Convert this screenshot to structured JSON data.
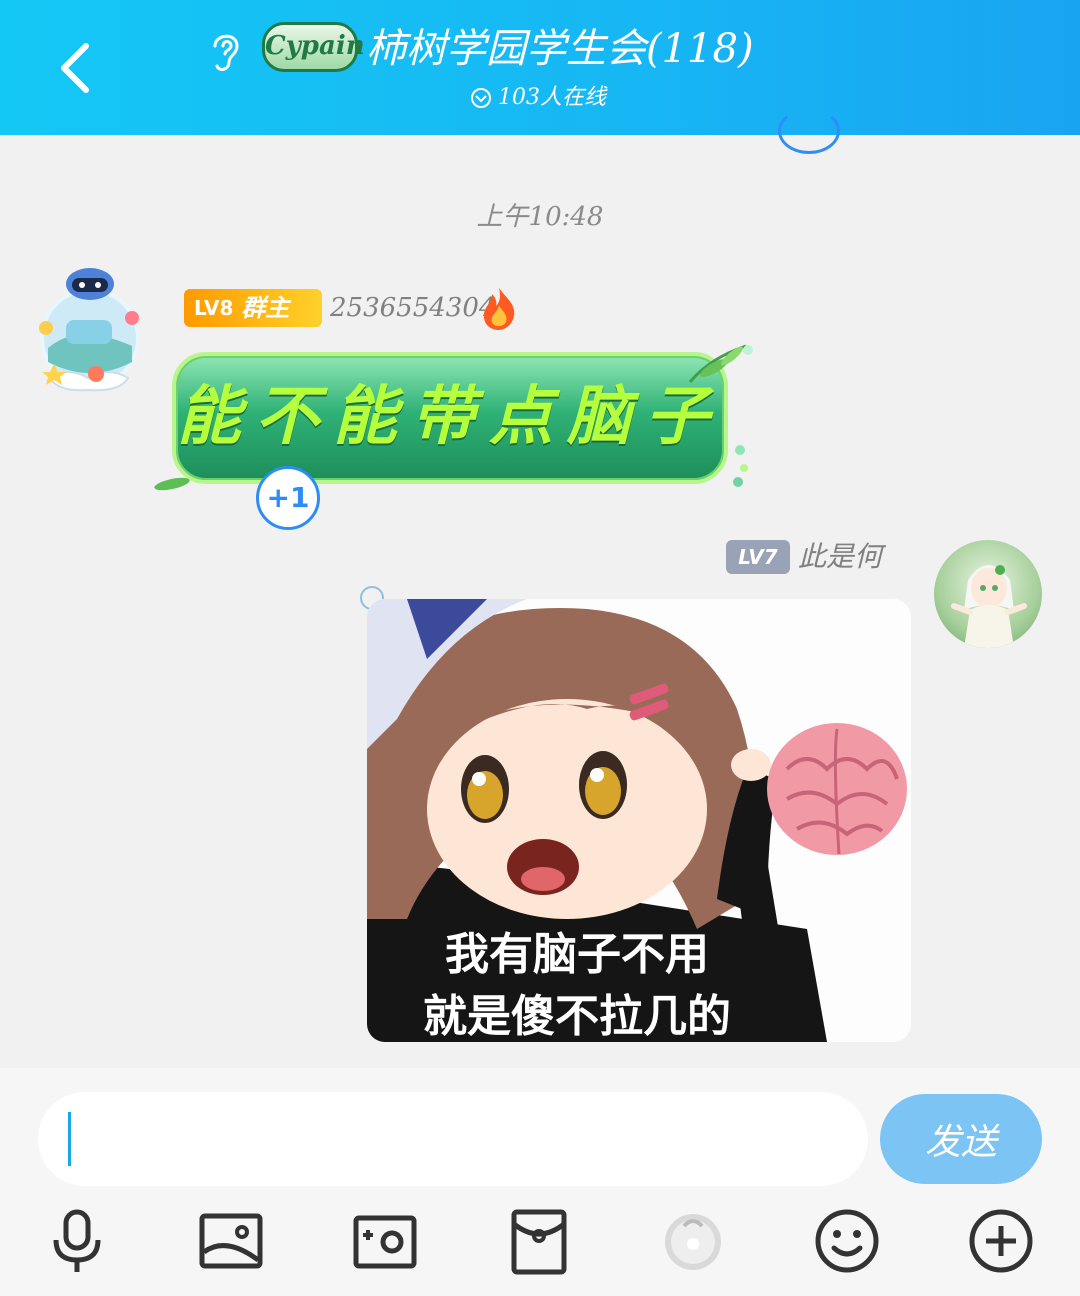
{
  "header": {
    "logo_text": "Cypain",
    "title": "柿树学园学生会(118)",
    "online": "103人在线"
  },
  "timestamp": "上午10:48",
  "messages": [
    {
      "level": "LV8",
      "role": "群主",
      "sender": "2536554304",
      "text": "能不能带点脑子",
      "plus_one": "+1"
    },
    {
      "level": "LV7",
      "sender": "此是何",
      "sticker_caption_1": "我有脑子不用",
      "sticker_caption_2": "就是傻不拉几的"
    }
  ],
  "input": {
    "value": "",
    "send_label": "发送"
  },
  "toolbar": {
    "icons": [
      "microphone-icon",
      "image-icon",
      "camera-icon",
      "red-packet-icon",
      "sticker-icon",
      "emoji-icon",
      "plus-icon"
    ]
  },
  "colors": {
    "header": "#17b6f4",
    "send_button": "#7cc4f4",
    "accent_blue": "#2d8cf5",
    "bubble_text": "#b6ff3d"
  }
}
